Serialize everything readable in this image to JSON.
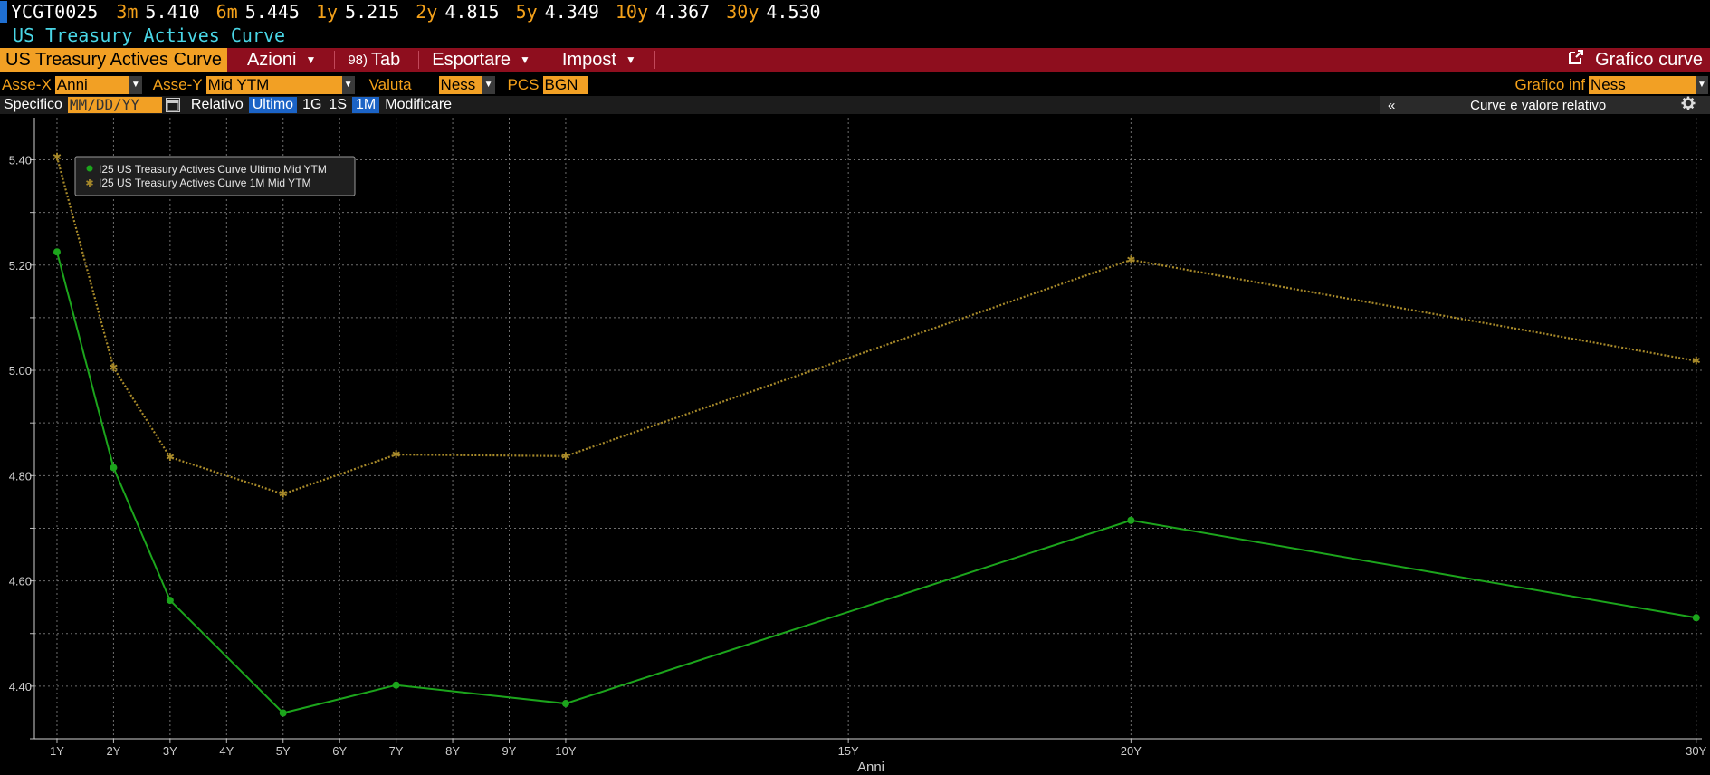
{
  "ticker": {
    "symbol": "YCGT0025",
    "quotes": [
      {
        "tenor": "3m",
        "value": "5.410"
      },
      {
        "tenor": "6m",
        "value": "5.445"
      },
      {
        "tenor": "1y",
        "value": "5.215"
      },
      {
        "tenor": "2y",
        "value": "4.815"
      },
      {
        "tenor": "5y",
        "value": "4.349"
      },
      {
        "tenor": "10y",
        "value": "4.367"
      },
      {
        "tenor": "30y",
        "value": "4.530"
      }
    ]
  },
  "subtitle": "US Treasury Actives Curve",
  "redbar": {
    "active_tab": "US Treasury Actives Curve",
    "menus": [
      {
        "label": "Azioni",
        "caret": true
      },
      {
        "label": "Tab",
        "prefix": "98)",
        "caret": false
      },
      {
        "label": "Esportare",
        "caret": true
      },
      {
        "label": "Impost",
        "caret": true
      }
    ],
    "right_label": "Grafico curve"
  },
  "axisrow": {
    "x_label": "Asse-X",
    "x_value": "Anni",
    "y_label": "Asse-Y",
    "y_value": "Mid YTM",
    "valuta_label": "Valuta",
    "valuta_value": "Ness",
    "pcs_label": "PCS",
    "pcs_value": "BGN",
    "grafico_label": "Grafico inf",
    "grafico_value": "Ness"
  },
  "toolrow": {
    "specifico": "Specifico",
    "date_placeholder": "MM/DD/YY",
    "relativo": "Relativo",
    "ultimo": "Ultimo",
    "g1": "1G",
    "s1": "1S",
    "m1": "1M",
    "modificare": "Modificare",
    "collapse": "«",
    "panel_title": "Curve e valore relativo"
  },
  "colors": {
    "green": "#1ca51c",
    "gold": "#a88a2a",
    "orange": "#f2a024",
    "red": "#8e0e1e",
    "cyan": "#49d6e6"
  },
  "chart_data": {
    "type": "line",
    "xlabel": "Anni",
    "ylabel": "",
    "ylim": [
      4.3,
      5.48
    ],
    "xlim": [
      0.6,
      30.1
    ],
    "x_ticks": [
      {
        "v": 1,
        "label": "1Y"
      },
      {
        "v": 2,
        "label": "2Y"
      },
      {
        "v": 3,
        "label": "3Y"
      },
      {
        "v": 4,
        "label": "4Y"
      },
      {
        "v": 5,
        "label": "5Y"
      },
      {
        "v": 6,
        "label": "6Y"
      },
      {
        "v": 7,
        "label": "7Y"
      },
      {
        "v": 8,
        "label": "8Y"
      },
      {
        "v": 9,
        "label": "9Y"
      },
      {
        "v": 10,
        "label": "10Y"
      },
      {
        "v": 15,
        "label": "15Y"
      },
      {
        "v": 20,
        "label": "20Y"
      },
      {
        "v": 30,
        "label": "30Y"
      }
    ],
    "y_ticks": [
      {
        "v": 4.4,
        "label": "4.40"
      },
      {
        "v": 4.6,
        "label": "4.60"
      },
      {
        "v": 4.8,
        "label": "4.80"
      },
      {
        "v": 5.0,
        "label": "5.00"
      },
      {
        "v": 5.2,
        "label": "5.20"
      },
      {
        "v": 5.4,
        "label": "5.40"
      }
    ],
    "y_minor": [
      4.3,
      4.5,
      4.7,
      4.9,
      5.1,
      5.3
    ],
    "grid": true,
    "legend_position": "top-left",
    "series": [
      {
        "name": "I25 US Treasury Actives Curve Ultimo Mid YTM",
        "style": "solid-dot",
        "x": [
          1,
          2,
          3,
          5,
          7,
          10,
          20,
          30
        ],
        "values": [
          5.225,
          4.815,
          4.563,
          4.349,
          4.402,
          4.367,
          4.715,
          4.53
        ]
      },
      {
        "name": "I25 US Treasury Actives Curve 1M Mid YTM",
        "style": "dotted-star",
        "x": [
          1,
          2,
          3,
          5,
          7,
          10,
          20,
          30
        ],
        "values": [
          5.405,
          5.005,
          4.835,
          4.765,
          4.84,
          4.837,
          5.21,
          5.018
        ]
      }
    ]
  }
}
